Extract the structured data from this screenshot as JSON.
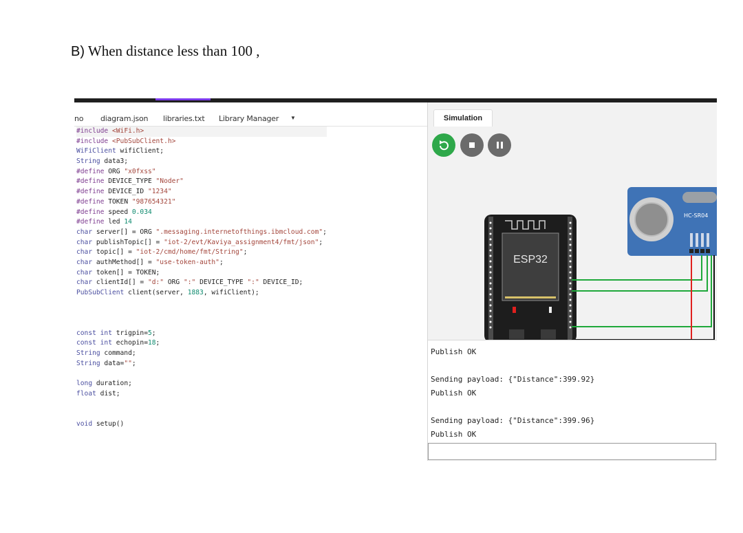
{
  "heading": {
    "letter": "B)",
    "text": "When distance less than 100 ,"
  },
  "editor": {
    "tabs": [
      {
        "label": "no"
      },
      {
        "label": "diagram.json"
      },
      {
        "label": "libraries.txt"
      },
      {
        "label": "Library Manager"
      }
    ],
    "dropdown_icon": "chevron-down-icon",
    "code": [
      "#include <WiFi.h>",
      "#include <PubSubClient.h>",
      "WiFiClient wifiClient;",
      "String data3;",
      "#define ORG \"x0fxss\"",
      "#define DEVICE_TYPE \"Noder\"",
      "#define DEVICE_ID \"1234\"",
      "#define TOKEN \"987654321\"",
      "#define speed 0.034",
      "#define led 14",
      "char server[] = ORG \".messaging.internetofthings.ibmcloud.com\";",
      "char publishTopic[] = \"iot-2/evt/Kaviya_assignment4/fmt/json\";",
      "char topic[] = \"iot-2/cmd/home/fmt/String\";",
      "char authMethod[] = \"use-token-auth\";",
      "char token[] = TOKEN;",
      "char clientId[] = \"d:\" ORG \":\" DEVICE_TYPE \":\" DEVICE_ID;",
      "PubSubClient client(server, 1883, wifiClient);",
      "",
      "",
      "",
      "const int trigpin=5;",
      "const int echopin=18;",
      "String command;",
      "String data=\"\";",
      "",
      "long duration;",
      "float dist;",
      "",
      "",
      "void setup()"
    ]
  },
  "simulation": {
    "tab_label": "Simulation",
    "buttons": {
      "restart_icon": "restart-icon",
      "stop_icon": "stop-icon",
      "pause_icon": "pause-icon"
    },
    "board_label": "ESP32",
    "sensor_label": "HC-SR04",
    "console": [
      "Publish OK",
      "",
      "Sending payload: {\"Distance\":399.92}",
      "Publish OK",
      "",
      "Sending payload: {\"Distance\":399.96}",
      "Publish OK"
    ]
  },
  "colors": {
    "play": "#2ea84a",
    "control": "#6b6b6b",
    "board": "#1d1d1d",
    "sensor": "#3f73b6",
    "wire_green": "#1ea83a",
    "wire_red": "#e0201e",
    "wire_black": "#111111"
  }
}
